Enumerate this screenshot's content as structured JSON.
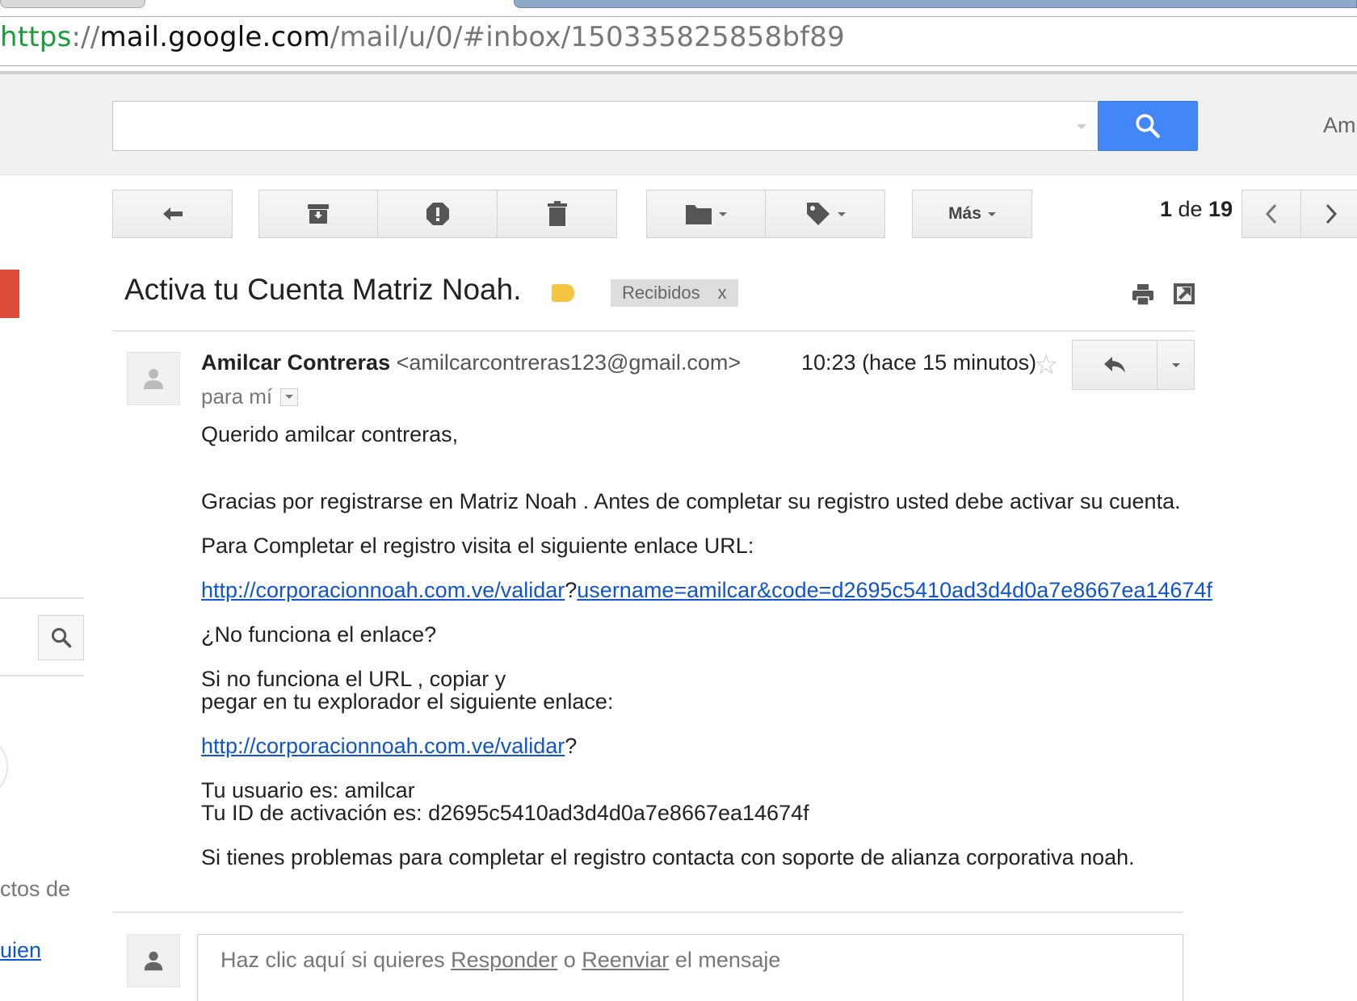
{
  "browser": {
    "url_scheme": "https",
    "url_sep": "://",
    "url_host": "mail.google.com",
    "url_path": "/mail/u/0/#inbox/150335825858bf89"
  },
  "header": {
    "search_placeholder": "",
    "account_partial": "Am"
  },
  "toolbar": {
    "more_label": "Más",
    "pager_current": "1",
    "pager_sep": " de ",
    "pager_total": "19"
  },
  "sidebar": {
    "partial_text_1": "ctos de",
    "partial_link": "uien"
  },
  "email": {
    "subject": "Activa tu Cuenta Matriz Noah.",
    "label_tag": "Recibidos",
    "label_remove": "x",
    "sender_name": "Amilcar Contreras",
    "sender_email": "<amilcarcontreras123@gmail.com>",
    "recipient": "para mí",
    "timestamp": "10:23 (hace 15 minutos)",
    "body": {
      "greeting": "Querido amilcar contreras,",
      "thanks": "Gracias por registrarse en Matriz Noah . Antes de completar su registro usted debe activar su cuenta.",
      "instruction": "Para Completar el registro visita el siguiente enlace URL:",
      "link_part1": "http://corporacionnoah.com.ve/validar",
      "link_q": "?",
      "link_part2": "username=amilcar&code=d2695c5410ad3d4d0a7e8667ea14674f",
      "not_working": "¿No funciona el enlace?",
      "copy_line1": "Si no funciona el URL , copiar y",
      "copy_line2": "pegar en tu explorador el siguiente enlace:",
      "link_base": "http://corporacionnoah.com.ve/validar",
      "link_base_q": "?",
      "user_line": "Tu usuario es: amilcar",
      "id_line": "Tu ID de activación es: d2695c5410ad3d4d0a7e8667ea14674f",
      "support": "Si tienes problemas para completar el registro contacta con soporte de alianza corporativa noah."
    }
  },
  "reply": {
    "prefix": "Haz clic aquí si quieres ",
    "reply_link": "Responder",
    "middle": " o ",
    "forward_link": "Reenviar",
    "suffix": " el mensaje"
  },
  "colors": {
    "search_button": "#4287f5",
    "compose": "#dd4b39",
    "label_chip": "#f4c542",
    "link": "#1155cc"
  }
}
